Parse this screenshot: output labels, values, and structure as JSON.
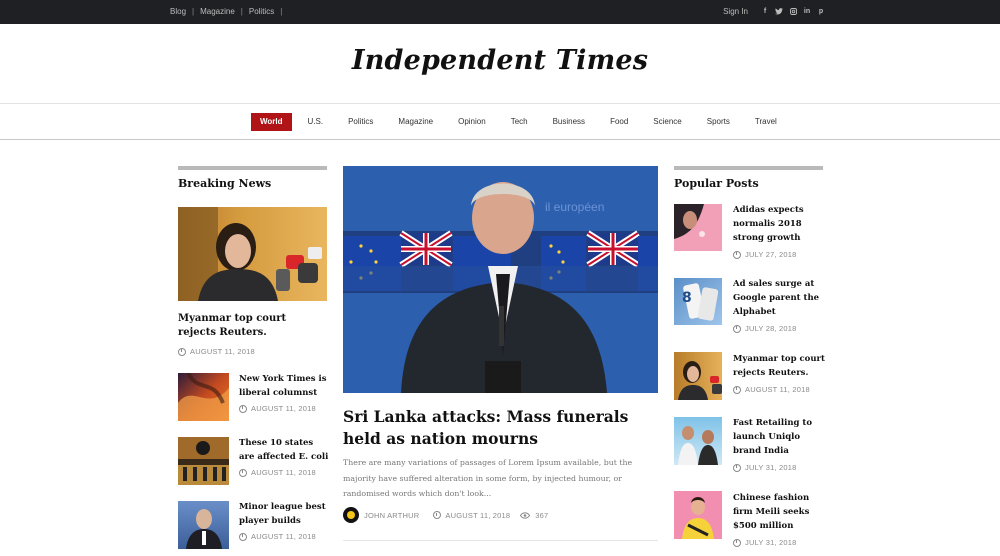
{
  "topbar": {
    "links": [
      "Blog",
      "Magazine",
      "Politics"
    ],
    "signin": "Sign In",
    "social": [
      "f",
      "t",
      "o",
      "in",
      "p"
    ]
  },
  "masthead": {
    "title": "Independent Times"
  },
  "nav": {
    "items": [
      "World",
      "U.S.",
      "Politics",
      "Magazine",
      "Opinion",
      "Tech",
      "Business",
      "Food",
      "Science",
      "Sports",
      "Travel"
    ],
    "active": "World"
  },
  "breaking": {
    "title": "Breaking News",
    "lead": {
      "headline": "Myanmar top court rejects Reuters.",
      "date": "AUGUST 11, 2018"
    },
    "items": [
      {
        "headline": "New York Times is liberal columnst",
        "date": "AUGUST 11, 2018"
      },
      {
        "headline": "These 10 states are affected E. coli",
        "date": "AUGUST 11, 2018"
      },
      {
        "headline": "Minor league best player builds",
        "date": "AUGUST 11, 2018"
      }
    ]
  },
  "feature": {
    "backdrop_text": "il européen",
    "headline": "Sri Lanka attacks: Mass funerals held as nation mourns",
    "excerpt": "There are many variations of passages of Lorem Ipsum available, but the majority have suffered alteration in some form, by injected humour, or randomised words which don't look...",
    "author": "JOHN ARTHUR",
    "date": "AUGUST 11, 2018",
    "views": "367"
  },
  "popular": {
    "title": "Popular Posts",
    "items": [
      {
        "headline": "Adidas expects normalis 2018 strong growth",
        "date": "JULY 27, 2018"
      },
      {
        "headline": "Ad sales surge at Google parent the Alphabet",
        "date": "JULY 28, 2018"
      },
      {
        "headline": "Myanmar top court rejects Reuters.",
        "date": "AUGUST 11, 2018"
      },
      {
        "headline": "Fast Retailing to launch Uniqlo brand India",
        "date": "JULY 31, 2018"
      },
      {
        "headline": "Chinese fashion firm Meili seeks $500 million",
        "date": "JULY 31, 2018"
      }
    ]
  },
  "colors": {
    "accent": "#b11417",
    "topbar": "#1f2024",
    "rule": "#b9b9b9"
  }
}
